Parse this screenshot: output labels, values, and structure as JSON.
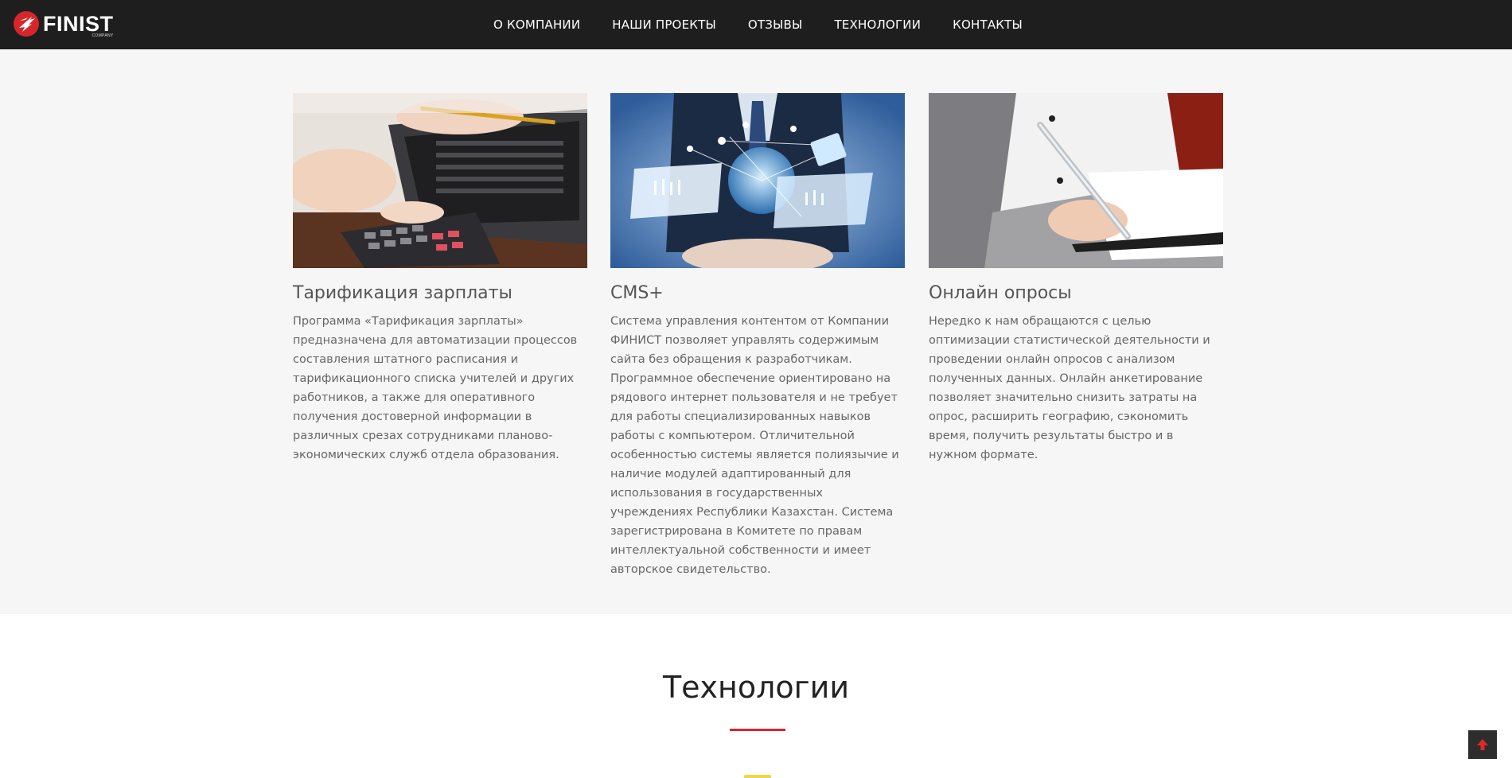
{
  "brand": {
    "name": "FINIST",
    "sub": "COMPANY",
    "accent": "#d7262b"
  },
  "nav": {
    "items": [
      "О КОМПАНИИ",
      "НАШИ ПРОЕКТЫ",
      "ОТЗЫВЫ",
      "ТЕХНОЛОГИИ",
      "КОНТАКТЫ"
    ]
  },
  "services": {
    "cards": [
      {
        "title": "Тарификация зарплаты",
        "text": "Программа «Тарификация зарплаты» предназначена для автоматизации процессов составления штатного расписания и тарификационного списка учителей и других работников, а также для оперативного получения достоверной информации в различных срезах сотрудниками планово-экономических служб отдела образования."
      },
      {
        "title": "CMS+",
        "text": "Система управления контентом от Компании ФИНИСТ позволяет управлять содержимым сайта без обращения к разработчикам. Программное обеспечение ориентировано на рядового интернет пользователя и не требует для работы специализированных навыков работы с компьютером. Отличительной особенностью системы является полиязычие и наличие модулей адаптированный для использования в государственных учреждениях Республики Казахстан. Система зарегистрирована в Комитете по правам интеллектуальной собственности и имеет авторское свидетельство."
      },
      {
        "title": "Онлайн опросы",
        "text": "Нередко к нам обращаются с целью оптимизации статистической деятельности и проведении онлайн опросов с анализом полученных данных. Онлайн анкетирование позволяет значительно снизить затраты на опрос, расширить географию, сэкономить время, получить результаты быстро и в нужном формате."
      }
    ]
  },
  "technologies": {
    "title": "Технологии"
  },
  "icons": {
    "scroll_top": "arrow-up-icon"
  }
}
